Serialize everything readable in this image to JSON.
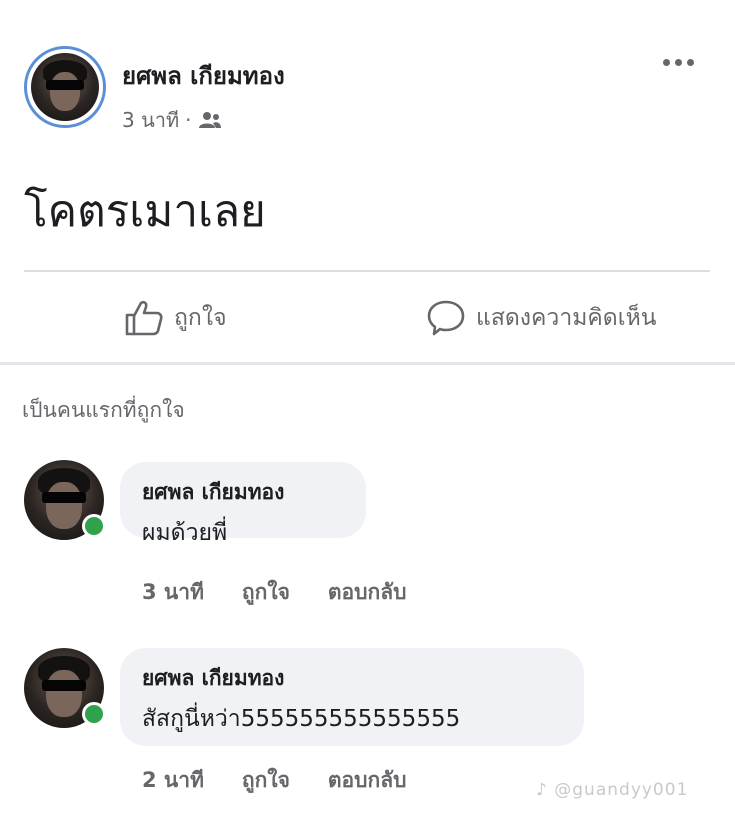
{
  "post": {
    "author": "ยศพล เกียมทอง",
    "time": "3 นาที",
    "separator": "·",
    "audience_icon": "friends-icon",
    "more_icon": "more-dots-icon",
    "text": "โคตรเมาเลย",
    "like_label": "ถูกใจ",
    "comment_label": "แสดงความคิดเห็น"
  },
  "likes_summary": "เป็นคนแรกที่ถูกใจ",
  "comments": [
    {
      "author": "ยศพล เกียมทอง",
      "text": "ผมด้วยพี่",
      "time": "3 นาที",
      "like_label": "ถูกใจ",
      "reply_label": "ตอบกลับ"
    },
    {
      "author": "ยศพล เกียมทอง",
      "text": "สัสกูนี่หว่า555555555555555",
      "time": "2 นาที",
      "like_label": "ถูกใจ",
      "reply_label": "ตอบกลับ"
    }
  ],
  "watermark": "@guandyy001",
  "colors": {
    "online": "#31a24c",
    "bubble": "#f0f2f5",
    "muted": "#65676b",
    "story_ring": "#5a8fd8"
  }
}
